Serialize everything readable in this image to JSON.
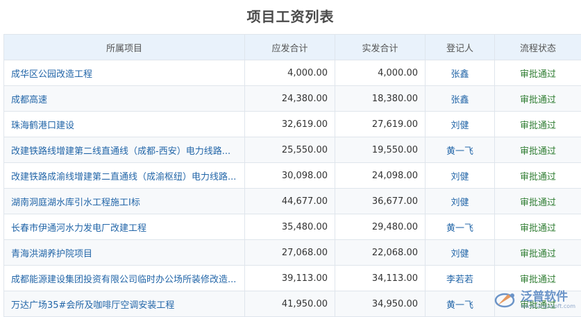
{
  "page": {
    "title": "项目工资列表"
  },
  "table": {
    "columns": [
      "所属项目",
      "应发合计",
      "实发合计",
      "登记人",
      "流程状态"
    ],
    "rows": [
      {
        "project": "成华区公园改造工程",
        "due": "4,000.00",
        "paid": "4,000.00",
        "registrar": "张鑫",
        "status": "审批通过"
      },
      {
        "project": "成都高速",
        "due": "24,380.00",
        "paid": "18,380.00",
        "registrar": "张鑫",
        "status": "审批通过"
      },
      {
        "project": "珠海鹤港口建设",
        "due": "32,619.00",
        "paid": "27,619.00",
        "registrar": "刘健",
        "status": "审批通过"
      },
      {
        "project": "改建铁路线增建第二线直通线（成都-西安）电力线路...",
        "due": "25,550.00",
        "paid": "19,550.00",
        "registrar": "黄一飞",
        "status": "审批通过"
      },
      {
        "project": "改建铁路成渝线增建第二直通线（成渝枢纽）电力线路...",
        "due": "30,098.00",
        "paid": "24,098.00",
        "registrar": "刘健",
        "status": "审批通过"
      },
      {
        "project": "湖南洞庭湖水库引水工程施工I标",
        "due": "44,677.00",
        "paid": "36,677.00",
        "registrar": "刘健",
        "status": "审批通过"
      },
      {
        "project": "长春市伊通河水力发电厂改建工程",
        "due": "35,480.00",
        "paid": "29,480.00",
        "registrar": "黄一飞",
        "status": "审批通过"
      },
      {
        "project": "青海洪湖养护院项目",
        "due": "27,068.00",
        "paid": "22,068.00",
        "registrar": "刘健",
        "status": "审批通过"
      },
      {
        "project": "成都能源建设集团投资有限公司临时办公场所装修改造...",
        "due": "39,113.00",
        "paid": "34,113.00",
        "registrar": "李若若",
        "status": "审批通过"
      },
      {
        "project": "万达广场35#会所及咖啡厅空调安装工程",
        "due": "41,950.00",
        "paid": "34,950.00",
        "registrar": "黄一飞",
        "status": "审批通过"
      }
    ]
  },
  "watermark": {
    "name": "泛普软件",
    "url": "www.fanpusoft.com"
  },
  "colors": {
    "link": "#2366a8",
    "status": "#2f7d32",
    "header_bg": "#e9f2fb"
  }
}
